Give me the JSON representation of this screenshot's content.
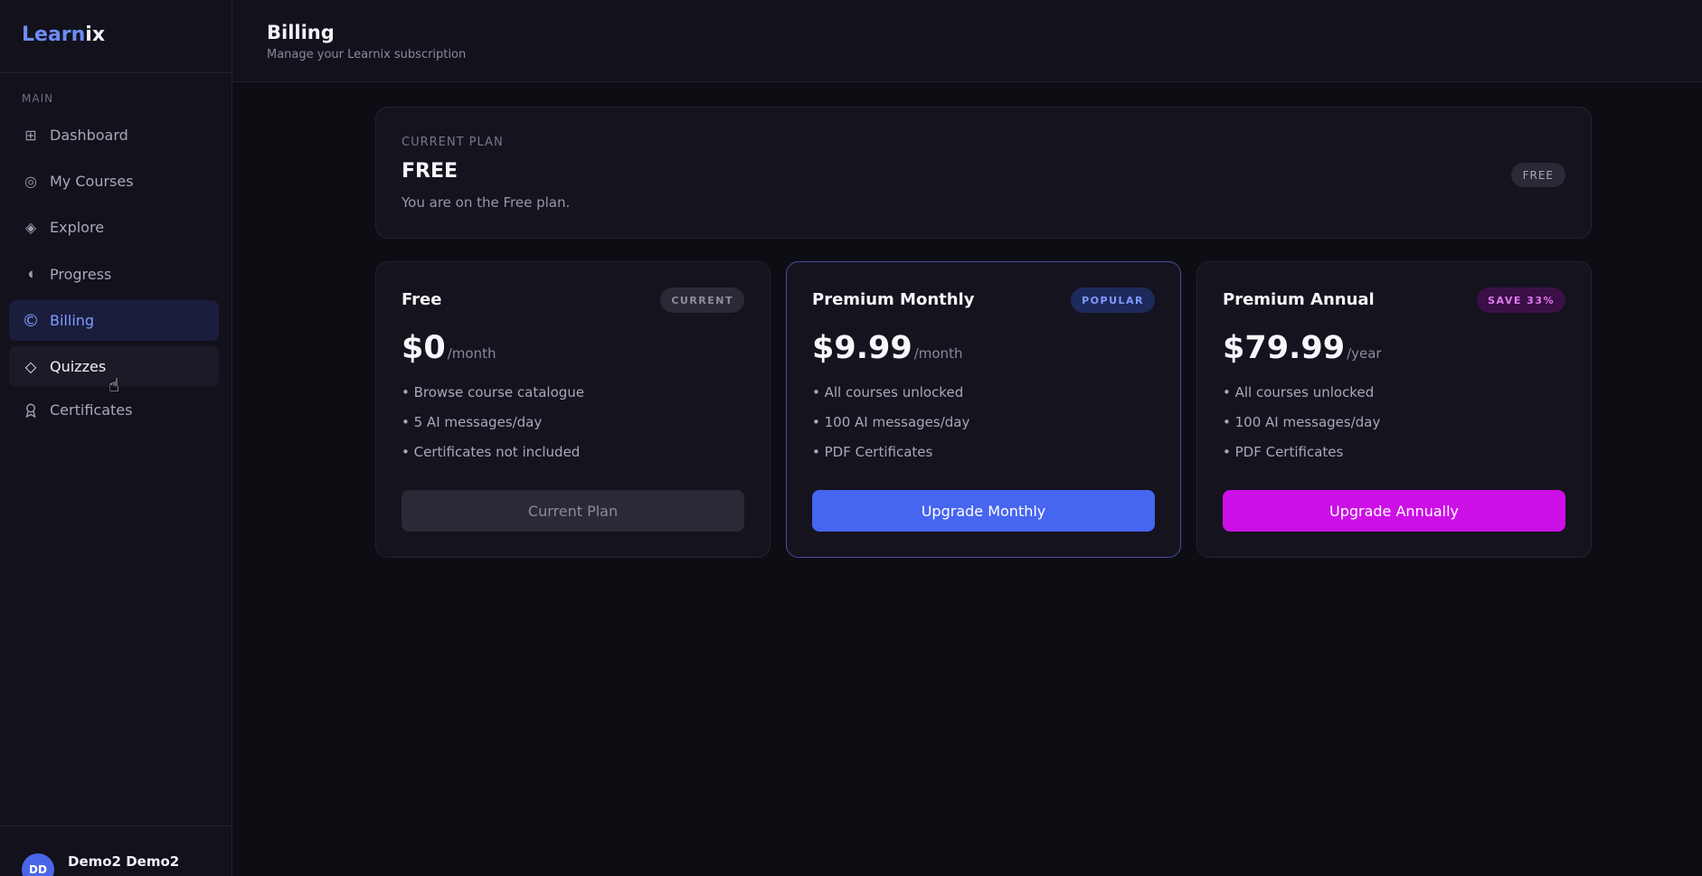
{
  "app": {
    "brand_part1": "Learn",
    "brand_part2": "ix"
  },
  "sidebar": {
    "section_label": "MAIN",
    "items": [
      {
        "label": "Dashboard",
        "icon": "grid-icon"
      },
      {
        "label": "My Courses",
        "icon": "target-icon"
      },
      {
        "label": "Explore",
        "icon": "diamond-filled-icon"
      },
      {
        "label": "Progress",
        "icon": "half-circle-icon"
      },
      {
        "label": "Billing",
        "icon": "copyright-icon",
        "active": true
      },
      {
        "label": "Quizzes",
        "icon": "diamond-outline-icon",
        "hover": true
      },
      {
        "label": "Certificates",
        "icon": "award-icon"
      }
    ],
    "user": {
      "initials": "DD",
      "name": "Demo2 Demo2"
    }
  },
  "header": {
    "title": "Billing",
    "subtitle": "Manage your Learnix subscription"
  },
  "current_plan": {
    "label": "CURRENT PLAN",
    "name": "FREE",
    "description": "You are on the Free plan.",
    "badge": "FREE"
  },
  "plans": [
    {
      "name": "Free",
      "badge": "CURRENT",
      "price": "$0",
      "period": "/month",
      "features": [
        "• Browse course catalogue",
        "• 5 AI messages/day",
        "• Certificates not included"
      ],
      "button": "Current Plan"
    },
    {
      "name": "Premium Monthly",
      "badge": "POPULAR",
      "price": "$9.99",
      "period": "/month",
      "features": [
        "• All courses unlocked",
        "• 100 AI messages/day",
        "• PDF Certificates"
      ],
      "button": "Upgrade Monthly"
    },
    {
      "name": "Premium Annual",
      "badge": "SAVE 33%",
      "price": "$79.99",
      "period": "/year",
      "features": [
        "• All courses unlocked",
        "• 100 AI messages/day",
        "• PDF Certificates"
      ],
      "button": "Upgrade Annually"
    }
  ],
  "colors": {
    "background": "#0d0d14",
    "accent_blue": "#4665f0",
    "accent_magenta": "#cc0fe6",
    "active_nav": "#7d9cff"
  }
}
